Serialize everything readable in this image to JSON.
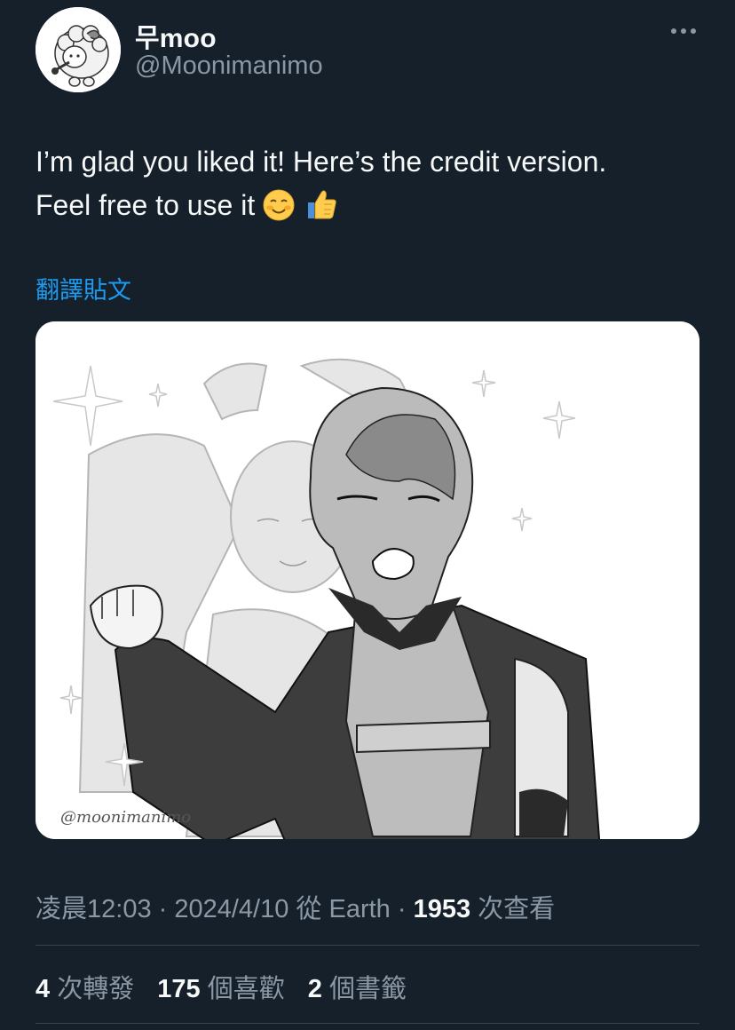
{
  "author": {
    "display_name": "무moo",
    "handle": "@Moonimanimo",
    "avatar_icon": "sheep-avatar-icon"
  },
  "menu": {
    "more_icon": "more-options-icon"
  },
  "tweet": {
    "line1": "I’m glad you liked it! Here’s the credit version.",
    "line2": "Feel free to use it",
    "emojis": [
      "smiling-face-icon",
      "thumbs-up-icon"
    ]
  },
  "translate_label": "翻譯貼文",
  "media": {
    "watermark": "@moonimanimo"
  },
  "meta": {
    "time": "凌晨12:03",
    "sep1": " · ",
    "date": "2024/4/10",
    "source": " 從 Earth",
    "sep2": " · ",
    "views_count": "1953",
    "views_label": " 次查看"
  },
  "stats": {
    "retweets_count": "4",
    "retweets_label": " 次轉發",
    "likes_count": "175",
    "likes_label": " 個喜歡",
    "bookmarks_count": "2",
    "bookmarks_label": " 個書籤"
  },
  "colors": {
    "background": "#15202b",
    "text": "#f7f9f9",
    "secondary": "#8b98a5",
    "link": "#1d9bf0",
    "divider": "#38444d"
  }
}
